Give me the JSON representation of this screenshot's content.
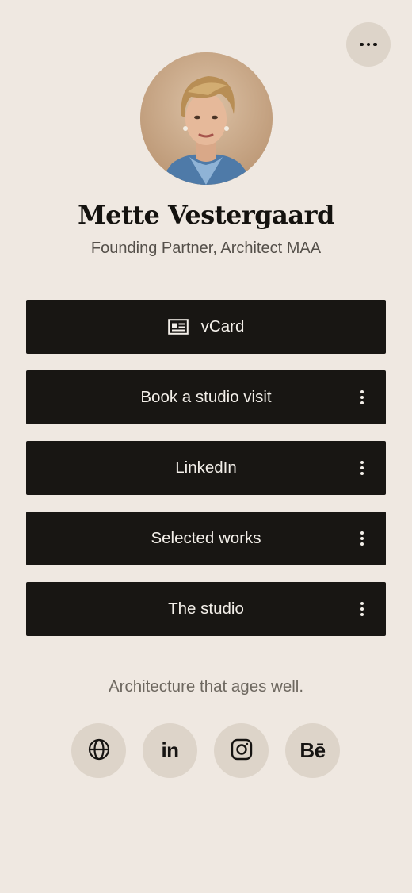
{
  "profile": {
    "name": "Mette Vestergaard",
    "title": "Founding Partner, Architect MAA"
  },
  "links": [
    {
      "label": "vCard",
      "icon": "id-card-icon",
      "has_menu": false
    },
    {
      "label": "Book a studio visit",
      "has_menu": true
    },
    {
      "label": "LinkedIn",
      "has_menu": true
    },
    {
      "label": "Selected works",
      "has_menu": true
    },
    {
      "label": "The studio",
      "has_menu": true
    }
  ],
  "tagline": "Architecture that ages well.",
  "socials": {
    "website": {
      "icon": "globe-icon"
    },
    "linkedin": {
      "icon": "linkedin-icon",
      "glyph": "in"
    },
    "instagram": {
      "icon": "instagram-icon"
    },
    "behance": {
      "icon": "behance-icon",
      "glyph": "Bē"
    }
  },
  "colors": {
    "background": "#efe8e1",
    "button": "#181613",
    "button_text": "#f3efe9",
    "circle": "#ddd4c9"
  }
}
